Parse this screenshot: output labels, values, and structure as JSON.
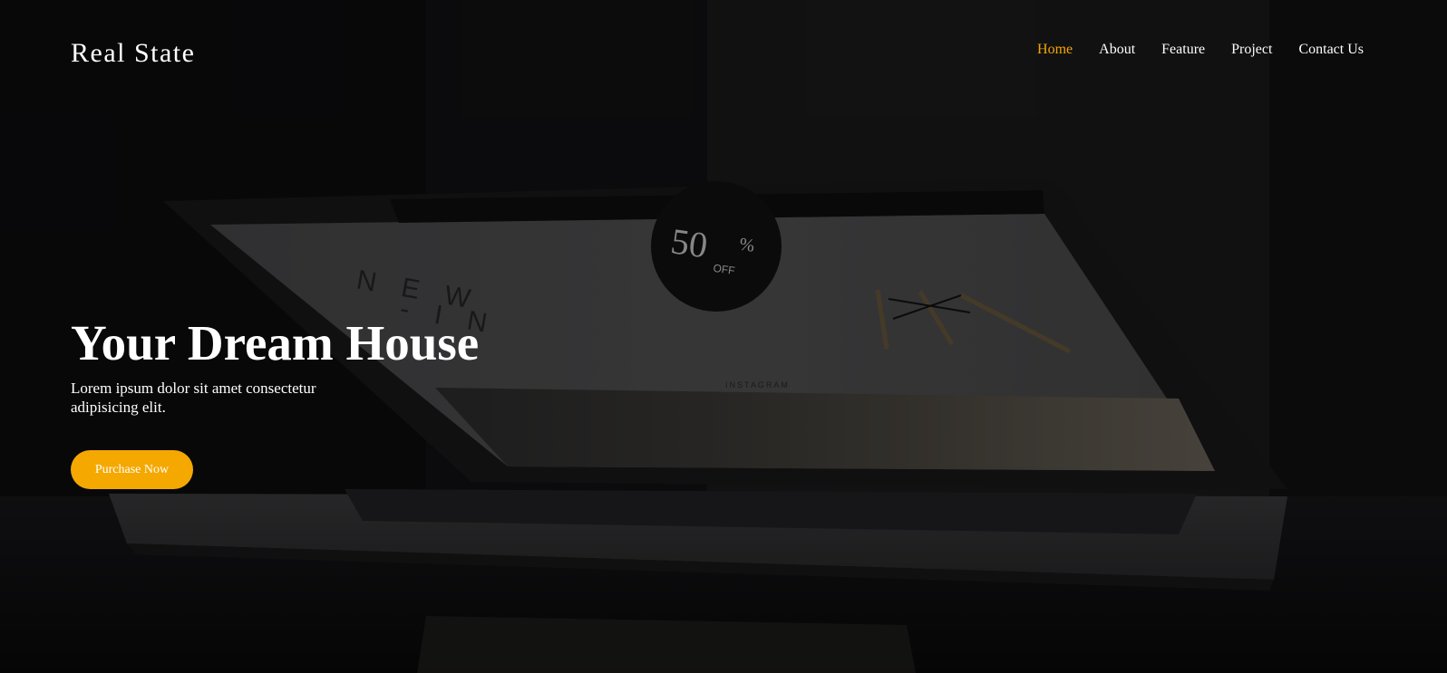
{
  "header": {
    "brand": "Real State",
    "nav": [
      {
        "label": "Home",
        "active": true
      },
      {
        "label": "About",
        "active": false
      },
      {
        "label": "Feature",
        "active": false
      },
      {
        "label": "Project",
        "active": false
      },
      {
        "label": "Contact Us",
        "active": false
      }
    ]
  },
  "hero": {
    "title": "Your Dream House",
    "subtitle": "Lorem ipsum dolor sit amet consectetur adipisicing elit.",
    "cta_label": "Purchase Now"
  },
  "background_image": {
    "screen_headline": "N E W\n- I N",
    "badge_value": "50",
    "badge_symbol": "%",
    "badge_text": "OFF",
    "screen_section": "INSTAGRAM"
  },
  "colors": {
    "accent": "#f5a800",
    "text": "#ffffff",
    "background": "#0b0b0d"
  }
}
